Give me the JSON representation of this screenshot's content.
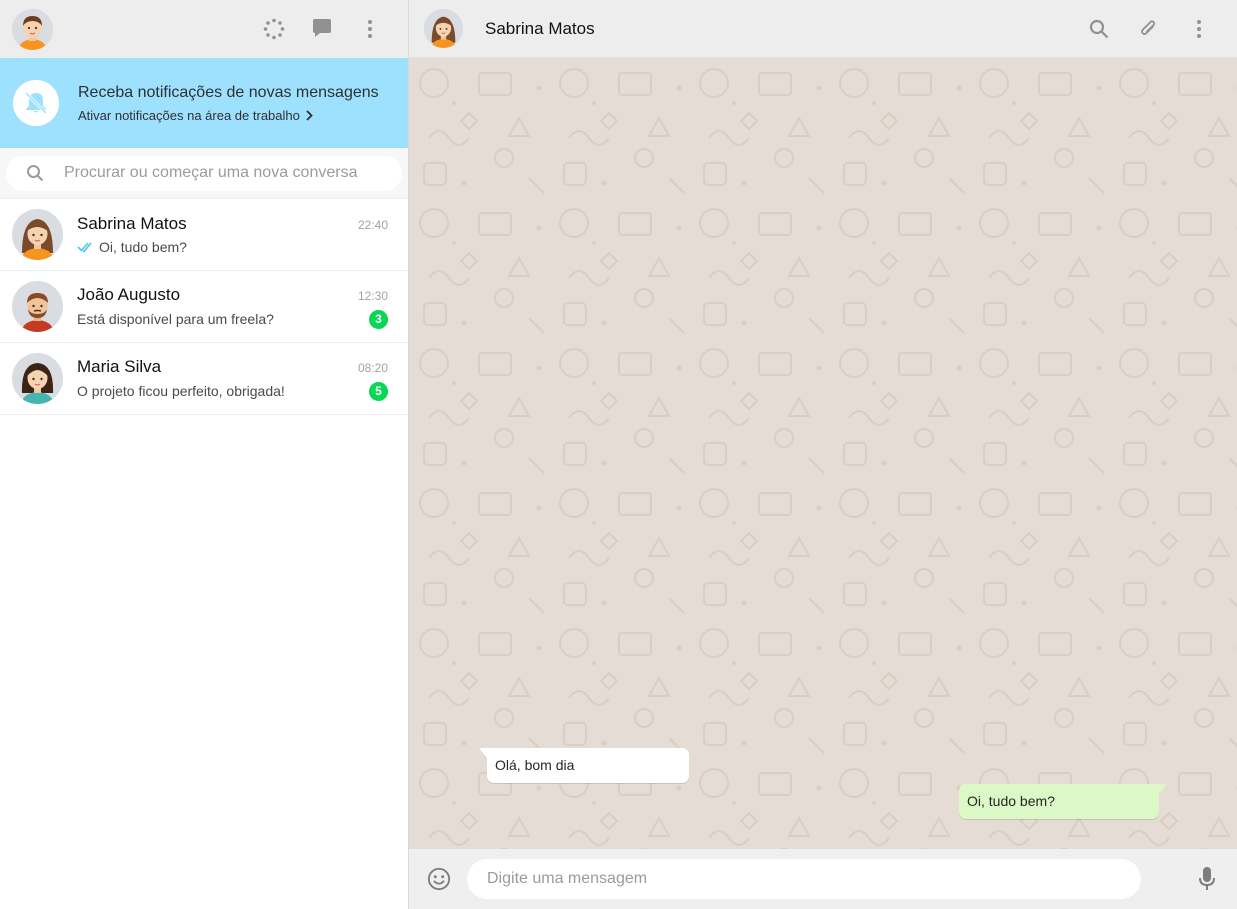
{
  "colors": {
    "header_bg": "#ededed",
    "notification_bg": "#9de1fe",
    "badge": "#06d755",
    "chat_bg": "#e5ddd5",
    "bubble_out": "#dcf8c6",
    "bubble_in": "#ffffff"
  },
  "left_header": {
    "icons": [
      "user-avatar-icon",
      "status-icon",
      "new-chat-icon",
      "menu-icon"
    ]
  },
  "notification": {
    "title": "Receba notificações de novas mensagens",
    "link": "Ativar notificações na área de trabalho",
    "icon": "bell-off-icon"
  },
  "search": {
    "placeholder": "Procurar ou começar uma nova conversa"
  },
  "chats": [
    {
      "name": "Sabrina Matos",
      "time": "22:40",
      "message": "Oi, tudo bem?",
      "status": "double-check",
      "unread": ""
    },
    {
      "name": "João Augusto",
      "time": "12:30",
      "message": "Está disponível para um freela?",
      "status": "",
      "unread": "3"
    },
    {
      "name": "Maria Silva",
      "time": "08:20",
      "message": "O projeto ficou perfeito, obrigada!",
      "status": "",
      "unread": "5"
    }
  ],
  "conversation": {
    "contact_name": "Sabrina Matos",
    "messages": [
      {
        "direction": "in",
        "text": "Olá, bom dia"
      },
      {
        "direction": "out",
        "text": "Oi, tudo bem?"
      }
    ]
  },
  "composer": {
    "placeholder": "Digite uma mensagem"
  }
}
